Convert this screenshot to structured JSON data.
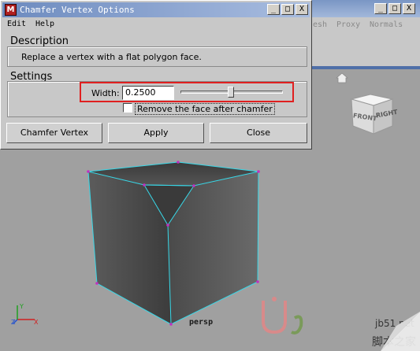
{
  "dialog": {
    "title": "Chamfer Vertex Options",
    "app_icon_glyph": "M",
    "menu": [
      "Edit",
      "Help"
    ],
    "description": {
      "heading": "Description",
      "text": "Replace a vertex with a flat polygon face."
    },
    "settings": {
      "heading": "Settings",
      "width_label": "Width:",
      "width_value": "0.2500",
      "slider_value": 0.5,
      "remove_face_label": "Remove the face after chamfer",
      "remove_face_checked": false
    },
    "buttons": {
      "chamfer": "Chamfer Vertex",
      "apply": "Apply",
      "close": "Close"
    },
    "window_buttons": {
      "minimize": "_",
      "maximize": "□",
      "close": "X"
    }
  },
  "app": {
    "menu": [
      "esh",
      "Proxy",
      "Normals"
    ],
    "window_buttons": {
      "minimize": "_",
      "maximize": "□",
      "close": "X"
    }
  },
  "viewport": {
    "camera_label": "persp",
    "viewcube": {
      "front": "FRONT",
      "right": "RIGHT"
    },
    "axis": {
      "x": "X",
      "y": "Y",
      "z": "Z"
    }
  },
  "watermark": {
    "site": "jb51.net",
    "cn_text": "脚本之家"
  },
  "colors": {
    "highlight": "#e02020",
    "wire": "#38d8e8",
    "vertex": "#c030c0"
  }
}
